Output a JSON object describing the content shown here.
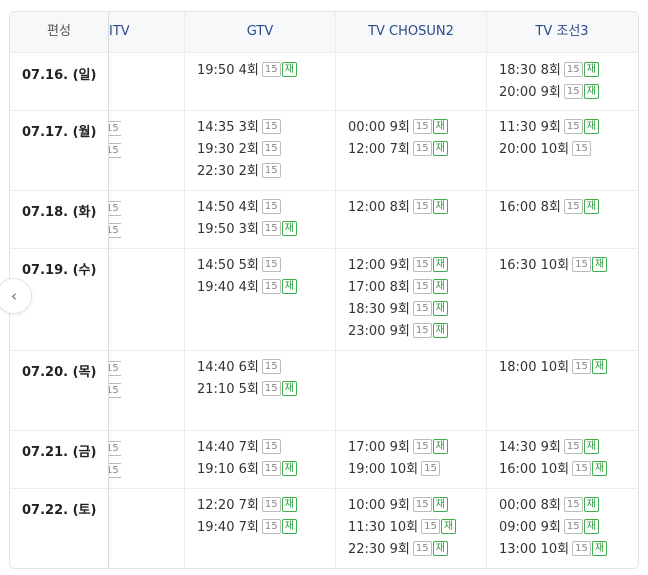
{
  "header": {
    "first_col": "편성",
    "channels": [
      "ITV",
      "GTV",
      "TV CHOSUN2",
      "TV 조선3"
    ]
  },
  "badges": {
    "age": "15",
    "rerun": "재"
  },
  "rows": [
    {
      "date": "07.16. (일)",
      "partial": 0,
      "gtv": [
        {
          "time": "19:50",
          "ep": "4회",
          "re": true
        }
      ],
      "chosun2": [],
      "chosun3": [
        {
          "time": "18:30",
          "ep": "8회",
          "re": true
        },
        {
          "time": "20:00",
          "ep": "9회",
          "re": true
        }
      ]
    },
    {
      "date": "07.17. (월)",
      "partial": 2,
      "gtv": [
        {
          "time": "14:35",
          "ep": "3회",
          "re": false
        },
        {
          "time": "19:30",
          "ep": "2회",
          "re": false
        },
        {
          "time": "22:30",
          "ep": "2회",
          "re": false
        }
      ],
      "chosun2": [
        {
          "time": "00:00",
          "ep": "9회",
          "re": true
        },
        {
          "time": "12:00",
          "ep": "7회",
          "re": true
        }
      ],
      "chosun3": [
        {
          "time": "11:30",
          "ep": "9회",
          "re": true
        },
        {
          "time": "20:00",
          "ep": "10회",
          "re": false
        }
      ]
    },
    {
      "date": "07.18. (화)",
      "partial": 2,
      "gtv": [
        {
          "time": "14:50",
          "ep": "4회",
          "re": false
        },
        {
          "time": "19:50",
          "ep": "3회",
          "re": true
        }
      ],
      "chosun2": [
        {
          "time": "12:00",
          "ep": "8회",
          "re": true
        }
      ],
      "chosun3": [
        {
          "time": "16:00",
          "ep": "8회",
          "re": true
        }
      ]
    },
    {
      "date": "07.19. (수)",
      "partial": 0,
      "gtv": [
        {
          "time": "14:50",
          "ep": "5회",
          "re": false
        },
        {
          "time": "19:40",
          "ep": "4회",
          "re": true
        }
      ],
      "chosun2": [
        {
          "time": "12:00",
          "ep": "9회",
          "re": true
        },
        {
          "time": "17:00",
          "ep": "8회",
          "re": true
        },
        {
          "time": "18:30",
          "ep": "9회",
          "re": true
        },
        {
          "time": "23:00",
          "ep": "9회",
          "re": true
        }
      ],
      "chosun3": [
        {
          "time": "16:30",
          "ep": "10회",
          "re": true
        }
      ]
    },
    {
      "date": "07.20. (목)",
      "partial": 2,
      "gtv": [
        {
          "time": "14:40",
          "ep": "6회",
          "re": false
        },
        {
          "time": "21:10",
          "ep": "5회",
          "re": true
        }
      ],
      "chosun2": [],
      "chosun3": [
        {
          "time": "18:00",
          "ep": "10회",
          "re": true
        }
      ]
    },
    {
      "date": "07.21. (금)",
      "partial": 2,
      "gtv": [
        {
          "time": "14:40",
          "ep": "7회",
          "re": false
        },
        {
          "time": "19:10",
          "ep": "6회",
          "re": true
        }
      ],
      "chosun2": [
        {
          "time": "17:00",
          "ep": "9회",
          "re": true
        },
        {
          "time": "19:00",
          "ep": "10회",
          "re": false
        }
      ],
      "chosun3": [
        {
          "time": "14:30",
          "ep": "9회",
          "re": true
        },
        {
          "time": "16:00",
          "ep": "10회",
          "re": true
        }
      ]
    },
    {
      "date": "07.22. (토)",
      "partial": 0,
      "gtv": [
        {
          "time": "12:20",
          "ep": "7회",
          "re": true
        },
        {
          "time": "19:40",
          "ep": "7회",
          "re": true
        }
      ],
      "chosun2": [
        {
          "time": "10:00",
          "ep": "9회",
          "re": true
        },
        {
          "time": "11:30",
          "ep": "10회",
          "re": true
        },
        {
          "time": "22:30",
          "ep": "9회",
          "re": true
        }
      ],
      "chosun3": [
        {
          "time": "00:00",
          "ep": "8회",
          "re": true
        },
        {
          "time": "09:00",
          "ep": "9회",
          "re": true
        },
        {
          "time": "13:00",
          "ep": "10회",
          "re": true
        }
      ]
    }
  ],
  "nav": {
    "prev_glyph": "‹"
  }
}
